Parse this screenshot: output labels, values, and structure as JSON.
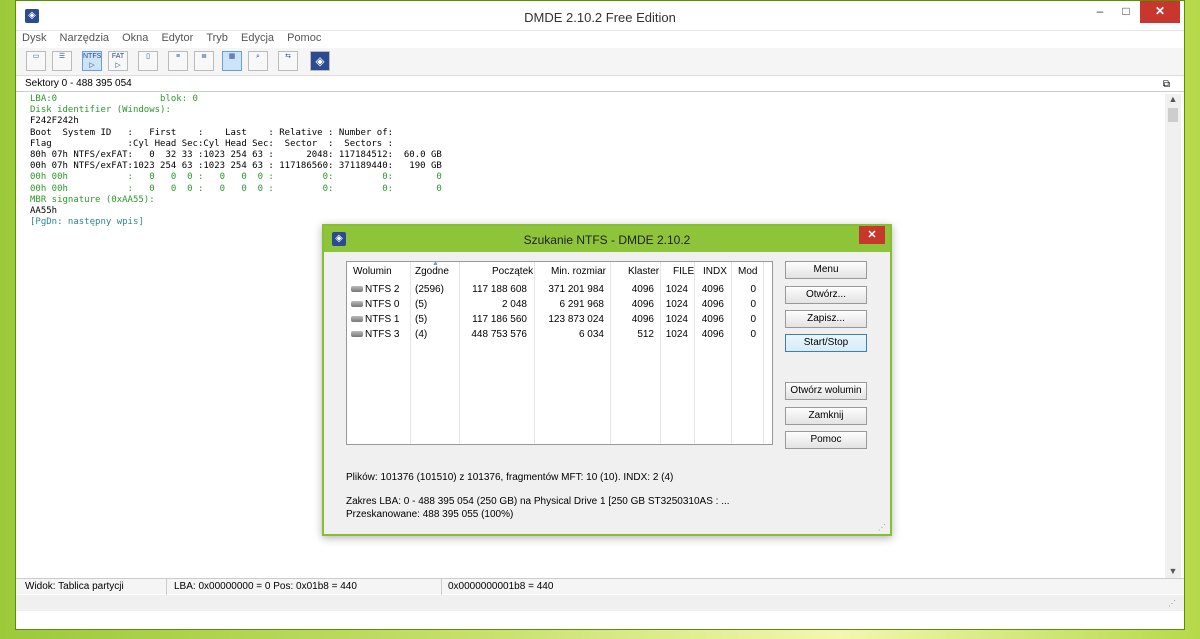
{
  "window": {
    "title": "DMDE 2.10.2 Free Edition",
    "icon": "dmde-logo-icon",
    "controls": {
      "minimize": "–",
      "maximize": "□",
      "close": "✕"
    }
  },
  "menu": [
    "Dysk",
    "Narzędzia",
    "Okna",
    "Edytor",
    "Tryb",
    "Edycja",
    "Pomoc"
  ],
  "toolbar": {
    "ntfs_label": "NTFS",
    "fat_label": "FAT"
  },
  "sector_bar": {
    "text": "Sektory 0 - 488 395 054",
    "icon": "restore-window-icon"
  },
  "textview": {
    "lines": [
      {
        "text": "LBA:0                   blok: 0",
        "color": "green"
      },
      {
        "text": "Disk identifier (Windows):",
        "color": "green"
      },
      {
        "text": "F242F242h",
        "color": "black"
      },
      {
        "text": "Boot  System ID   :   First    :    Last    : Relative : Number of:",
        "color": "black"
      },
      {
        "text": "Flag              :Cyl Head Sec:Cyl Head Sec:  Sector  :  Sectors :",
        "color": "black"
      },
      {
        "text": "80h 07h NTFS/exFAT:   0  32 33 :1023 254 63 :      2048: 117184512:  60.0 GB",
        "color": "black"
      },
      {
        "text": "00h 07h NTFS/exFAT:1023 254 63 :1023 254 63 : 117186560: 371189440:   190 GB",
        "color": "black"
      },
      {
        "text": "00h 00h           :   0   0  0 :   0   0  0 :         0:         0:        0",
        "color": "green"
      },
      {
        "text": "00h 00h           :   0   0  0 :   0   0  0 :         0:         0:        0",
        "color": "green"
      },
      {
        "text": "MBR signature (0xAA55):",
        "color": "green"
      },
      {
        "text": "AA55h",
        "color": "black"
      },
      {
        "text": "[PgDn: następny wpis]",
        "color": "teal"
      }
    ]
  },
  "status": {
    "view": "Widok: Tablica partycji",
    "lba": "LBA: 0x00000000 = 0  Pos: 0x01b8 = 440",
    "offset": "0x0000000001b8 = 440"
  },
  "dialog": {
    "title": "Szukanie NTFS - DMDE 2.10.2",
    "close": "✕",
    "columns": [
      "Wolumin",
      "Zgodne",
      "Początek",
      "Min. rozmiar",
      "Klaster",
      "FILE",
      "INDX",
      "Mod"
    ],
    "rows": [
      {
        "volume": "NTFS 2",
        "match": "(2596)",
        "start": "117 188 608",
        "min_size": "371 201 984",
        "cluster": "4096",
        "file": "1024",
        "indx": "4096",
        "mod": "0"
      },
      {
        "volume": "NTFS 0",
        "match": "(5)",
        "start": "2 048",
        "min_size": "6 291 968",
        "cluster": "4096",
        "file": "1024",
        "indx": "4096",
        "mod": "0"
      },
      {
        "volume": "NTFS 1",
        "match": "(5)",
        "start": "117 186 560",
        "min_size": "123 873 024",
        "cluster": "4096",
        "file": "1024",
        "indx": "4096",
        "mod": "0"
      },
      {
        "volume": "NTFS 3",
        "match": "(4)",
        "start": "448 753 576",
        "min_size": "6 034",
        "cluster": "512",
        "file": "1024",
        "indx": "4096",
        "mod": "0"
      }
    ],
    "buttons": {
      "menu": "Menu",
      "open": "Otwórz...",
      "save": "Zapisz...",
      "start_stop": "Start/Stop",
      "open_volume": "Otwórz wolumin",
      "close": "Zamknij",
      "help": "Pomoc"
    },
    "files_info": "Plików: 101376 (101510) z 101376, fragmentów MFT: 10 (10). INDX: 2 (4)",
    "lba_range": "Zakres LBA: 0 - 488 395 054 (250 GB) na Physical Drive 1 [250 GB ST3250310AS : ...",
    "scanned": "Przeskanowane: 488 395 055 (100%)"
  },
  "colors": {
    "accent_green": "#8ec43a",
    "text_green": "#2a9a2a",
    "text_teal": "#2a8a8a",
    "close_red": "#c8372d"
  }
}
